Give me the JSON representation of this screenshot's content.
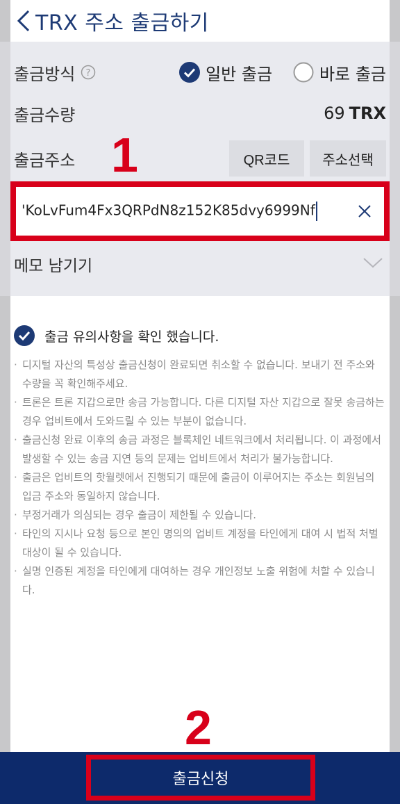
{
  "header": {
    "title": "TRX 주소 출금하기"
  },
  "method": {
    "label": "출금방식",
    "options": [
      {
        "label": "일반 출금",
        "selected": true
      },
      {
        "label": "바로 출금",
        "selected": false
      }
    ]
  },
  "amount": {
    "label": "출금수량",
    "value": "69",
    "unit": "TRX"
  },
  "address": {
    "label": "출금주소",
    "qr_button": "QR코드",
    "select_button": "주소선택",
    "value": "'KoLvFum4Fx3QRPdN8z152K85dvy6999Nf"
  },
  "memo": {
    "label": "메모 남기기"
  },
  "confirm": {
    "label": "출금 유의사항을 확인 했습니다.",
    "checked": true
  },
  "notes": [
    "디지털 자산의 특성상 출금신청이 완료되면 취소할 수 없습니다. 보내기 전 주소와 수량을 꼭 확인해주세요.",
    "트론은 트론 지갑으로만 송금 가능합니다. 다른 디지털 자산 지갑으로 잘못 송금하는 경우 업비트에서 도와드릴 수 있는 부분이 없습니다.",
    "출금신청 완료 이후의 송금 과정은 블록체인 네트워크에서 처리됩니다. 이 과정에서 발생할 수 있는 송금 지연 등의 문제는 업비트에서 처리가 불가능합니다.",
    "출금은 업비트의 핫월렛에서 진행되기 때문에 출금이 이루어지는 주소는 회원님의 입금 주소와 동일하지 않습니다.",
    "부정거래가 의심되는 경우 출금이 제한될 수 있습니다.",
    "타인의 지시나 요청 등으로 본인 명의의 업비트 계정을 타인에게 대여 시 법적 처벌 대상이 될 수 있습니다.",
    "실명 인증된 계정을 타인에게 대여하는 경우 개인정보 노출 위험에 처할 수 있습니다."
  ],
  "submit": {
    "label": "출금신청"
  },
  "annotations": {
    "marker_1": "1",
    "marker_2": "2"
  },
  "colors": {
    "primary": "#1d3a75",
    "highlight": "#d8001a",
    "bottom_bar": "#0d2a6b"
  },
  "icons": {
    "back": "chevron-left-icon",
    "help": "question-circle-icon",
    "clear": "close-icon",
    "memo_toggle": "chevron-down-icon",
    "check": "check-icon"
  }
}
